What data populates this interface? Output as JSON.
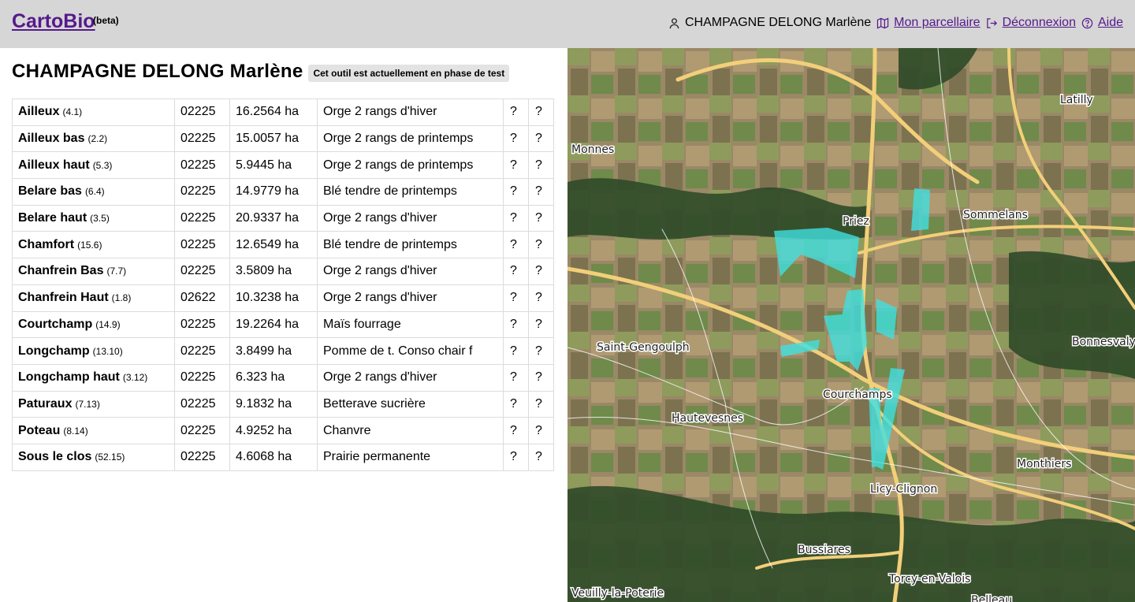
{
  "header": {
    "brand": "CartoBio",
    "beta": "(beta)",
    "user_name": "CHAMPAGNE DELONG Marlène",
    "parcellaire_label": " Mon parcellaire",
    "logout_label": " Déconnexion",
    "help_label": " Aide"
  },
  "main": {
    "title": "CHAMPAGNE DELONG Marlène",
    "badge": "Cet outil est actuellement en phase de test"
  },
  "parcels": [
    {
      "name": "Ailleux",
      "ref": "(4.1)",
      "code": "02225",
      "area": "16.2564 ha",
      "crop": "Orge 2 rangs d'hiver",
      "c1": "?",
      "c2": "?"
    },
    {
      "name": "Ailleux bas",
      "ref": "(2.2)",
      "code": "02225",
      "area": "15.0057 ha",
      "crop": "Orge 2 rangs de printemps",
      "c1": "?",
      "c2": "?"
    },
    {
      "name": "Ailleux haut",
      "ref": "(5.3)",
      "code": "02225",
      "area": "5.9445 ha",
      "crop": "Orge 2 rangs de printemps",
      "c1": "?",
      "c2": "?"
    },
    {
      "name": "Belare bas",
      "ref": "(6.4)",
      "code": "02225",
      "area": "14.9779 ha",
      "crop": "Blé tendre de printemps",
      "c1": "?",
      "c2": "?"
    },
    {
      "name": "Belare haut",
      "ref": "(3.5)",
      "code": "02225",
      "area": "20.9337 ha",
      "crop": "Orge 2 rangs d'hiver",
      "c1": "?",
      "c2": "?"
    },
    {
      "name": "Chamfort",
      "ref": "(15.6)",
      "code": "02225",
      "area": "12.6549 ha",
      "crop": "Blé tendre de printemps",
      "c1": "?",
      "c2": "?"
    },
    {
      "name": "Chanfrein Bas",
      "ref": "(7.7)",
      "code": "02225",
      "area": "3.5809 ha",
      "crop": "Orge 2 rangs d'hiver",
      "c1": "?",
      "c2": "?"
    },
    {
      "name": "Chanfrein Haut",
      "ref": "(1.8)",
      "code": "02622",
      "area": "10.3238 ha",
      "crop": "Orge 2 rangs d'hiver",
      "c1": "?",
      "c2": "?"
    },
    {
      "name": "Courtchamp",
      "ref": "(14.9)",
      "code": "02225",
      "area": "19.2264 ha",
      "crop": "Maïs fourrage",
      "c1": "?",
      "c2": "?"
    },
    {
      "name": "Longchamp",
      "ref": "(13.10)",
      "code": "02225",
      "area": "3.8499 ha",
      "crop": "Pomme de t. Conso chair f",
      "c1": "?",
      "c2": "?"
    },
    {
      "name": "Longchamp haut",
      "ref": "(3.12)",
      "code": "02225",
      "area": "6.323 ha",
      "crop": "Orge 2 rangs d'hiver",
      "c1": "?",
      "c2": "?"
    },
    {
      "name": "Paturaux",
      "ref": "(7.13)",
      "code": "02225",
      "area": "9.1832 ha",
      "crop": "Betterave sucrière",
      "c1": "?",
      "c2": "?"
    },
    {
      "name": "Poteau",
      "ref": "(8.14)",
      "code": "02225",
      "area": "4.9252 ha",
      "crop": "Chanvre",
      "c1": "?",
      "c2": "?"
    },
    {
      "name": "Sous le clos",
      "ref": "(52.15)",
      "code": "02225",
      "area": "4.6068 ha",
      "crop": "Prairie permanente",
      "c1": "?",
      "c2": "?"
    }
  ],
  "map": {
    "places": [
      "Latilly",
      "Monnes",
      "Priez",
      "Sommelans",
      "Saint-Gengoulph",
      "Bonnesvalyn",
      "Courchamps",
      "Hautevesnes",
      "Monthiers",
      "Licy-Clignon",
      "Bussiares",
      "Torcy-en-Valois",
      "Veuilly-la-Poterie",
      "Belleau"
    ],
    "parcel_color": "#40e0e0",
    "road_color": "#f3cf7a"
  }
}
